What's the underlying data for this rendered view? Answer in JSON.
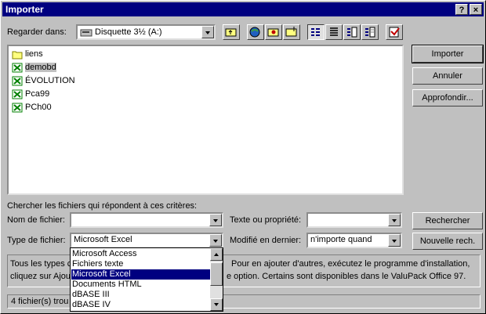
{
  "window": {
    "title": "Importer",
    "help_label": "?",
    "close_label": "×"
  },
  "lookin": {
    "label": "Regarder dans:",
    "value": "Disquette 3½ (A:)"
  },
  "toolbar": {
    "icons": [
      "up-folder-icon",
      "search-web-icon",
      "favorites-icon",
      "add-favorites-icon",
      "list-view-icon",
      "details-view-icon",
      "properties-view-icon",
      "preview-view-icon",
      "commands-icon"
    ]
  },
  "files": [
    {
      "name": "liens",
      "type": "folder"
    },
    {
      "name": "demobd",
      "type": "excel"
    },
    {
      "name": "ÉVOLUTION",
      "type": "excel"
    },
    {
      "name": "Pca99",
      "type": "excel"
    },
    {
      "name": "PCh00",
      "type": "excel"
    }
  ],
  "buttons": {
    "import": "Importer",
    "cancel": "Annuler",
    "advanced": "Approfondir...",
    "search": "Rechercher",
    "new_search": "Nouvelle rech."
  },
  "criteria": {
    "heading": "Chercher les fichiers qui répondent à ces critères:",
    "filename_label": "Nom de fichier:",
    "filename_value": "",
    "text_label": "Texte ou propriété:",
    "text_value": "",
    "filetype_label": "Type de fichier:",
    "filetype_value": "Microsoft Excel",
    "modified_label": "Modifié en dernier:",
    "modified_value": "n'importe quand"
  },
  "filetype_options": [
    "Microsoft Access",
    "Fichiers texte",
    "Microsoft Excel",
    "Documents HTML",
    "dBASE III",
    "dBASE IV"
  ],
  "info": {
    "line1_left": "Tous les types c",
    "line1_right": "Pour en ajouter d'autres, exécutez le programme d'installation,",
    "line2_left": "cliquez sur Ajou",
    "line2_right": "e option. Certains sont disponibles dans le ValuPack Office 97."
  },
  "status": "4 fichier(s) trou",
  "colors": {
    "titlebar": "#000080",
    "face": "#c0c0c0",
    "highlight": "#000080",
    "excel_green": "#008000"
  }
}
